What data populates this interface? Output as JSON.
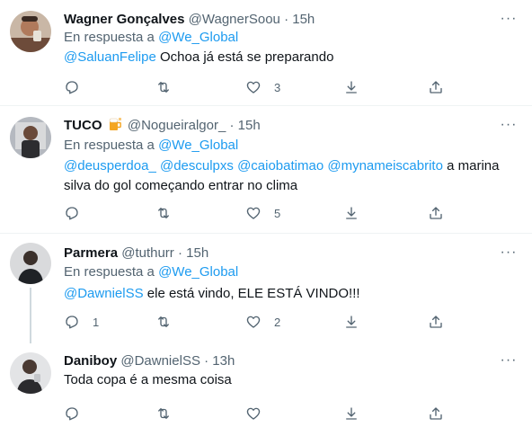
{
  "tweets": [
    {
      "name": "Wagner Gonçalves",
      "handle": "@WagnerSoou",
      "separator": "·",
      "time": "15h",
      "reply_prefix": "En respuesta a",
      "reply_to": "@We_Global",
      "mentions": "@SaluanFelipe",
      "text": "Ochoa já  está se preparando",
      "counts": {
        "replies": "",
        "retweets": "",
        "likes": "3"
      }
    },
    {
      "name": "TUCO",
      "handle": "@Nogueiralgor_",
      "separator": "·",
      "time": "15h",
      "reply_prefix": "En respuesta a",
      "reply_to": "@We_Global",
      "mentions": "@deusperdoa_ @desculpxs @caiobatimao @mynameiscabrito",
      "text_line1": "a marina",
      "text_line2": "silva do gol começando entrar no clima",
      "counts": {
        "replies": "",
        "retweets": "",
        "likes": "5"
      }
    },
    {
      "name": "Parmera",
      "handle": "@tuthurr",
      "separator": "·",
      "time": "15h",
      "reply_prefix": "En respuesta a",
      "reply_to": "@We_Global",
      "mentions": "@DawnielSS",
      "text": "ele está vindo, ELE ESTÁ VINDO!!!",
      "counts": {
        "replies": "1",
        "retweets": "",
        "likes": "2"
      }
    },
    {
      "name": "Daniboy",
      "handle": "@DawnielSS",
      "separator": "·",
      "time": "13h",
      "text": "Toda copa é a mesma coisa"
    }
  ],
  "icons": {
    "reply": "reply-icon",
    "retweet": "retweet-icon",
    "like": "heart-icon",
    "download": "download-icon",
    "share": "share-icon",
    "more": "more-icon",
    "beer": "beer-emoji-icon"
  },
  "colors": {
    "link": "#1d9bf0",
    "secondary": "#536471",
    "text": "#0f1419",
    "divider": "#eff3f4",
    "thread_line": "#cfd9de"
  }
}
